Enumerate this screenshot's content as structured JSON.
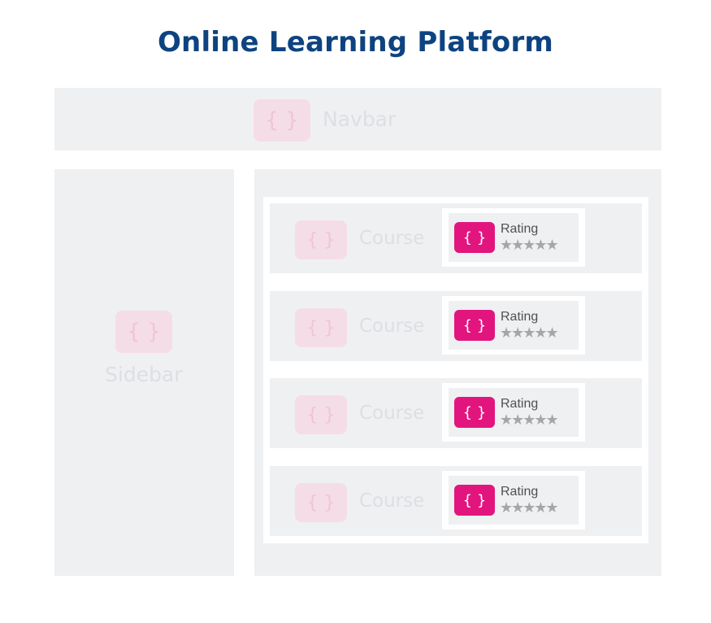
{
  "title": "Online Learning Platform",
  "navbar": {
    "label": "Navbar",
    "icon": "{ }"
  },
  "sidebar": {
    "label": "Sidebar",
    "icon": "{ }"
  },
  "courses": [
    {
      "label": "Course",
      "icon": "{ }",
      "rating": {
        "label": "Rating",
        "icon": "{ }",
        "stars": "★★★★★"
      }
    },
    {
      "label": "Course",
      "icon": "{ }",
      "rating": {
        "label": "Rating",
        "icon": "{ }",
        "stars": "★★★★★"
      }
    },
    {
      "label": "Course",
      "icon": "{ }",
      "rating": {
        "label": "Rating",
        "icon": "{ }",
        "stars": "★★★★★"
      }
    },
    {
      "label": "Course",
      "icon": "{ }",
      "rating": {
        "label": "Rating",
        "icon": "{ }",
        "stars": "★★★★★"
      }
    }
  ],
  "colors": {
    "title": "#0d4380",
    "accent": "#e2157e",
    "panel": "#eff0f2",
    "faded_badge": "#f5dde8"
  }
}
